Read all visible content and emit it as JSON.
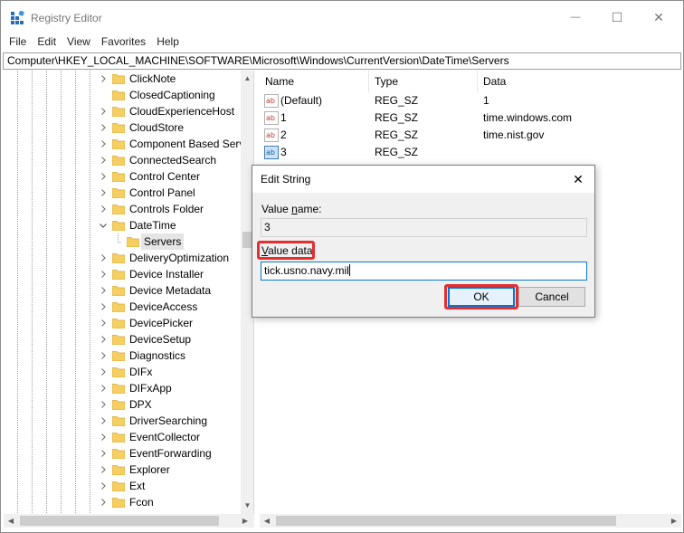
{
  "window": {
    "title": "Registry Editor",
    "minimize_glyph": "—",
    "maximize_glyph": "☐",
    "close_glyph": "✕"
  },
  "menu": [
    "File",
    "Edit",
    "View",
    "Favorites",
    "Help"
  ],
  "address": "Computer\\HKEY_LOCAL_MACHINE\\SOFTWARE\\Microsoft\\Windows\\CurrentVersion\\DateTime\\Servers",
  "tree": {
    "items": [
      {
        "label": "ClickNote",
        "expander": ">"
      },
      {
        "label": "ClosedCaptioning",
        "expander": ""
      },
      {
        "label": "CloudExperienceHost",
        "expander": ">"
      },
      {
        "label": "CloudStore",
        "expander": ">"
      },
      {
        "label": "Component Based Serv",
        "expander": ">"
      },
      {
        "label": "ConnectedSearch",
        "expander": ">"
      },
      {
        "label": "Control Center",
        "expander": ">"
      },
      {
        "label": "Control Panel",
        "expander": ">"
      },
      {
        "label": "Controls Folder",
        "expander": ">"
      },
      {
        "label": "DateTime",
        "expander": "v"
      },
      {
        "label": "Servers",
        "expander": "",
        "child": true
      },
      {
        "label": "DeliveryOptimization",
        "expander": ">"
      },
      {
        "label": "Device Installer",
        "expander": ">"
      },
      {
        "label": "Device Metadata",
        "expander": ">"
      },
      {
        "label": "DeviceAccess",
        "expander": ">"
      },
      {
        "label": "DevicePicker",
        "expander": ">"
      },
      {
        "label": "DeviceSetup",
        "expander": ">"
      },
      {
        "label": "Diagnostics",
        "expander": ">"
      },
      {
        "label": "DIFx",
        "expander": ">"
      },
      {
        "label": "DIFxApp",
        "expander": ">"
      },
      {
        "label": "DPX",
        "expander": ">"
      },
      {
        "label": "DriverSearching",
        "expander": ">"
      },
      {
        "label": "EventCollector",
        "expander": ">"
      },
      {
        "label": "EventForwarding",
        "expander": ">"
      },
      {
        "label": "Explorer",
        "expander": ">"
      },
      {
        "label": "Ext",
        "expander": ">"
      },
      {
        "label": "Fcon",
        "expander": ">"
      }
    ]
  },
  "list": {
    "columns": [
      "Name",
      "Type",
      "Data"
    ],
    "rows": [
      {
        "name": "(Default)",
        "type": "REG_SZ",
        "data": "1",
        "selected": false
      },
      {
        "name": "1",
        "type": "REG_SZ",
        "data": "time.windows.com",
        "selected": false
      },
      {
        "name": "2",
        "type": "REG_SZ",
        "data": "time.nist.gov",
        "selected": false
      },
      {
        "name": "3",
        "type": "REG_SZ",
        "data": "",
        "selected": true
      }
    ]
  },
  "dialog": {
    "title": "Edit String",
    "close_glyph": "✕",
    "value_name_label_pre": "Value ",
    "value_name_label_key": "n",
    "value_name_label_post": "ame:",
    "value_name": "3",
    "value_data_label_pre": "",
    "value_data_label_key": "V",
    "value_data_label_post": "alue data:",
    "value_data": "tick.usno.navy.mil",
    "ok_label": "OK",
    "cancel_label": "Cancel"
  },
  "colors": {
    "highlight": "#e62e2e",
    "focus": "#0078d7",
    "folder": "#f5cf62"
  }
}
